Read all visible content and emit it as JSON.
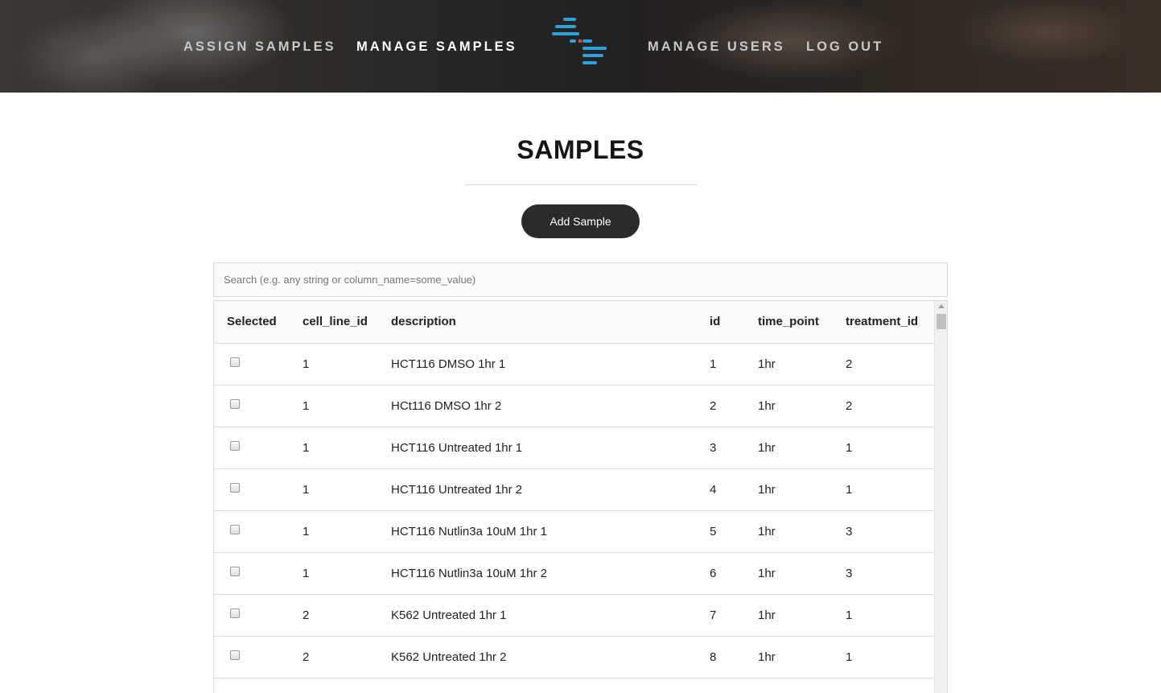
{
  "nav": {
    "assign": "ASSIGN SAMPLES",
    "manage": "MANAGE SAMPLES",
    "users": "MANAGE USERS",
    "logout": "LOG OUT"
  },
  "page": {
    "title": "SAMPLES",
    "add_button": "Add Sample"
  },
  "search": {
    "placeholder": "Search (e.g. any string or column_name=some_value)"
  },
  "table": {
    "headers": {
      "selected": "Selected",
      "cell_line_id": "cell_line_id",
      "description": "description",
      "id": "id",
      "time_point": "time_point",
      "treatment_id": "treatment_id"
    },
    "rows": [
      {
        "cell_line_id": "1",
        "description": "HCT116 DMSO 1hr 1",
        "id": "1",
        "time_point": "1hr",
        "treatment_id": "2"
      },
      {
        "cell_line_id": "1",
        "description": "HCt116 DMSO 1hr 2",
        "id": "2",
        "time_point": "1hr",
        "treatment_id": "2"
      },
      {
        "cell_line_id": "1",
        "description": "HCT116 Untreated 1hr 1",
        "id": "3",
        "time_point": "1hr",
        "treatment_id": "1"
      },
      {
        "cell_line_id": "1",
        "description": "HCT116 Untreated 1hr 2",
        "id": "4",
        "time_point": "1hr",
        "treatment_id": "1"
      },
      {
        "cell_line_id": "1",
        "description": "HCT116 Nutlin3a 10uM 1hr 1",
        "id": "5",
        "time_point": "1hr",
        "treatment_id": "3"
      },
      {
        "cell_line_id": "1",
        "description": "HCT116 Nutlin3a 10uM 1hr 2",
        "id": "6",
        "time_point": "1hr",
        "treatment_id": "3"
      },
      {
        "cell_line_id": "2",
        "description": "K562 Untreated 1hr 1",
        "id": "7",
        "time_point": "1hr",
        "treatment_id": "1"
      },
      {
        "cell_line_id": "2",
        "description": "K562 Untreated 1hr 2",
        "id": "8",
        "time_point": "1hr",
        "treatment_id": "1"
      },
      {
        "cell_line_id": "",
        "description": "",
        "id": "",
        "time_point": "",
        "treatment_id": ""
      }
    ]
  },
  "colors": {
    "logo_blue": "#29a3dd",
    "logo_red": "#e0463c",
    "button_bg": "#2b2b2b"
  }
}
